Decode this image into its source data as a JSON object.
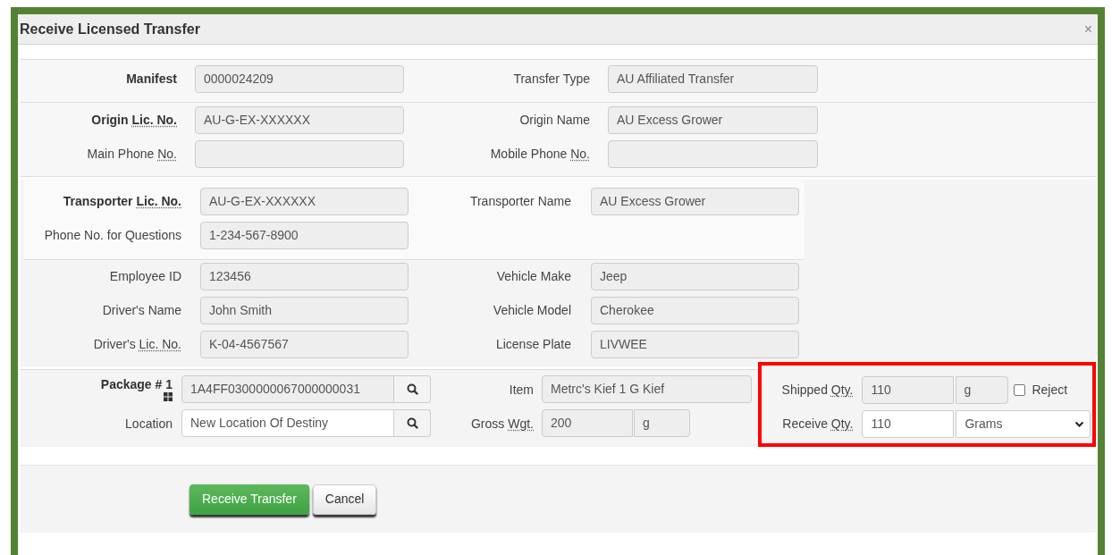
{
  "dialog": {
    "title": "Receive Licensed Transfer",
    "close": "×"
  },
  "sections": [
    {
      "rows": [
        [
          {
            "label": "Manifest",
            "bold": true,
            "value": "0000024209",
            "disabled": true
          },
          {
            "label": "Transfer Type",
            "value": "AU Affiliated Transfer",
            "disabled": true
          }
        ]
      ]
    },
    {
      "rows": [
        [
          {
            "label": "Origin",
            "abbr": "Lic. No.",
            "bold": true,
            "value": "AU-G-EX-XXXXXX",
            "disabled": true
          },
          {
            "label": "Origin Name",
            "value": "AU Excess Grower",
            "disabled": true
          }
        ],
        [
          {
            "label": "Main Phone",
            "abbr": "No.",
            "disabled": true
          },
          {
            "label": "Mobile Phone",
            "abbr": "No.",
            "disabled": true
          }
        ]
      ]
    },
    {
      "rows": [
        [
          {
            "label": "Transporter",
            "abbr": "Lic. No.",
            "bold": true,
            "value": "AU-G-EX-XXXXXX",
            "disabled": true
          },
          {
            "label": "Transporter Name",
            "value": "AU Excess Grower",
            "disabled": true
          }
        ],
        [
          {
            "label": "Phone No. for Questions",
            "value": "1-234-567-8900",
            "disabled": true
          }
        ]
      ]
    },
    {
      "rows": [
        [
          {
            "label": "Employee ID",
            "value": "123456",
            "disabled": true
          },
          {
            "label": "Vehicle Make",
            "value": "Jeep",
            "disabled": true
          }
        ],
        [
          {
            "label": "Driver's Name",
            "value": "John Smith",
            "disabled": true
          },
          {
            "label": "Vehicle Model",
            "value": "Cherokee",
            "disabled": true
          }
        ],
        [
          {
            "label": "Driver's",
            "abbr": "Lic. No.",
            "value": "K-04-4567567",
            "disabled": true
          },
          {
            "label": "License Plate",
            "value": "LIVWEE",
            "disabled": true
          }
        ]
      ]
    }
  ],
  "package": {
    "rows": [
      [
        {
          "label": "Package # 1",
          "bold": true,
          "grid_icon": true,
          "value": "1A4FF0300000067000000031",
          "disabled": true,
          "search": true
        },
        {
          "label": "Item",
          "value": "Metrc's Kief 1 G Kief",
          "disabled": true
        }
      ],
      [
        {
          "label": "Location",
          "value": "New Location Of Destiny",
          "disabled": false,
          "search": true
        },
        {
          "label": "Gross",
          "abbr": "Wgt.",
          "value": "200",
          "unit": "g",
          "disabled": true
        }
      ]
    ]
  },
  "quantities": {
    "highlighted": true,
    "shipped": {
      "label": "Shipped",
      "abbr": "Qty.",
      "value": "110",
      "unit": "g",
      "disabled": true
    },
    "reject": {
      "label": "Reject",
      "checked": false
    },
    "receive": {
      "label": "Receive",
      "abbr": "Qty.",
      "value": "110",
      "unit": "Grams",
      "disabled": false
    }
  },
  "buttons": [
    {
      "label": "Receive Transfer",
      "kind": "primary"
    },
    {
      "label": "Cancel",
      "kind": "default"
    }
  ]
}
